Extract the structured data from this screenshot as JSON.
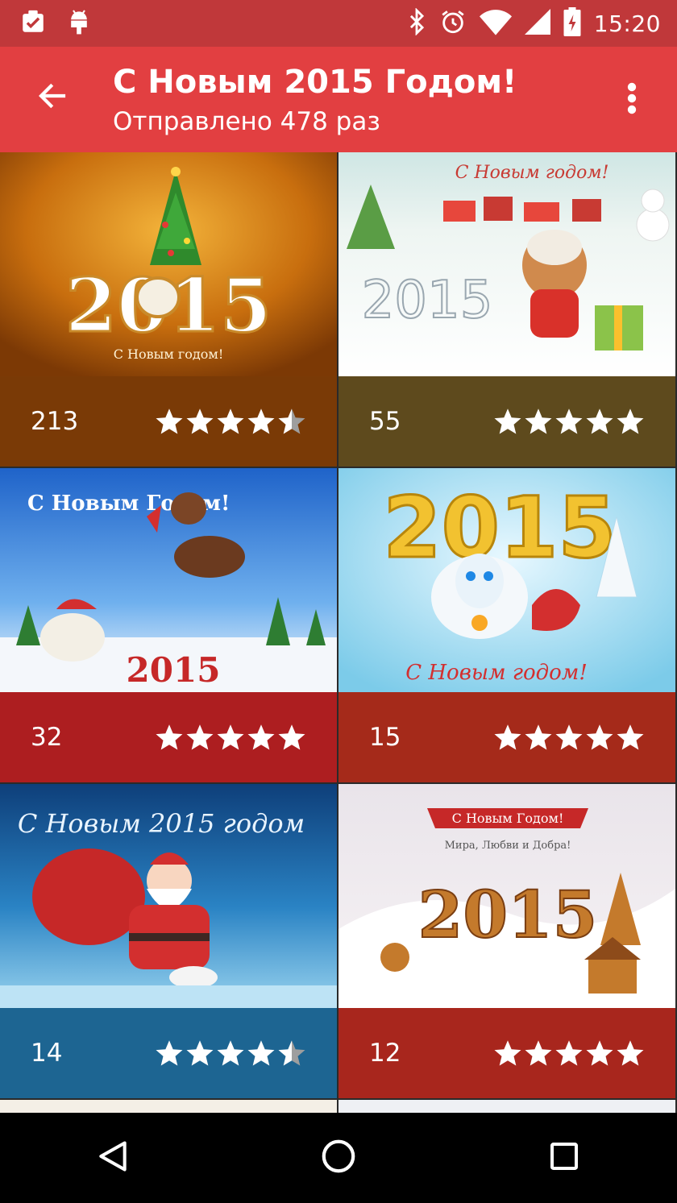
{
  "status_bar": {
    "time": "15:20",
    "left_icons": [
      "clipboard-check-icon",
      "android-icon"
    ],
    "right_icons": [
      "bluetooth-icon",
      "alarm-icon",
      "wifi-icon",
      "signal-icon",
      "battery-charging-icon"
    ]
  },
  "app_bar": {
    "title": "С Новым 2015 Годом!",
    "subtitle": "Отправлено 478 раз",
    "back_icon": "arrow-back-icon",
    "menu_icon": "more-vert-icon"
  },
  "cards": [
    {
      "count": "213",
      "rating": 4.5,
      "footer_color": "#7a3a06",
      "art_text": "С Новым годом!",
      "art_year": "2015"
    },
    {
      "count": "55",
      "rating": 5,
      "footer_color": "#5e4a1d",
      "art_text": "С Новым годом!",
      "art_year": "2015"
    },
    {
      "count": "32",
      "rating": 5,
      "footer_color": "#ad1e20",
      "art_text": "С Новым Годом!",
      "art_year": "2015"
    },
    {
      "count": "15",
      "rating": 5,
      "footer_color": "#a52a1a",
      "art_text": "С Новым годом!",
      "art_year": "2015"
    },
    {
      "count": "14",
      "rating": 4.5,
      "footer_color": "#1d6592",
      "art_text": "С Новым 2015 годом",
      "art_year": ""
    },
    {
      "count": "12",
      "rating": 5,
      "footer_color": "#a8261d",
      "art_text": "С Новым Годом!",
      "art_year": "2015",
      "art_sub": "Мира, Любви и Добра!"
    }
  ],
  "colors": {
    "status_bar": "#c0383a",
    "app_bar": "#e23f41",
    "star_full": "#ffffff",
    "star_empty": "#9e9e9e"
  },
  "nav_bar": {
    "icons": [
      "back-triangle-icon",
      "home-circle-icon",
      "recents-square-icon"
    ]
  }
}
